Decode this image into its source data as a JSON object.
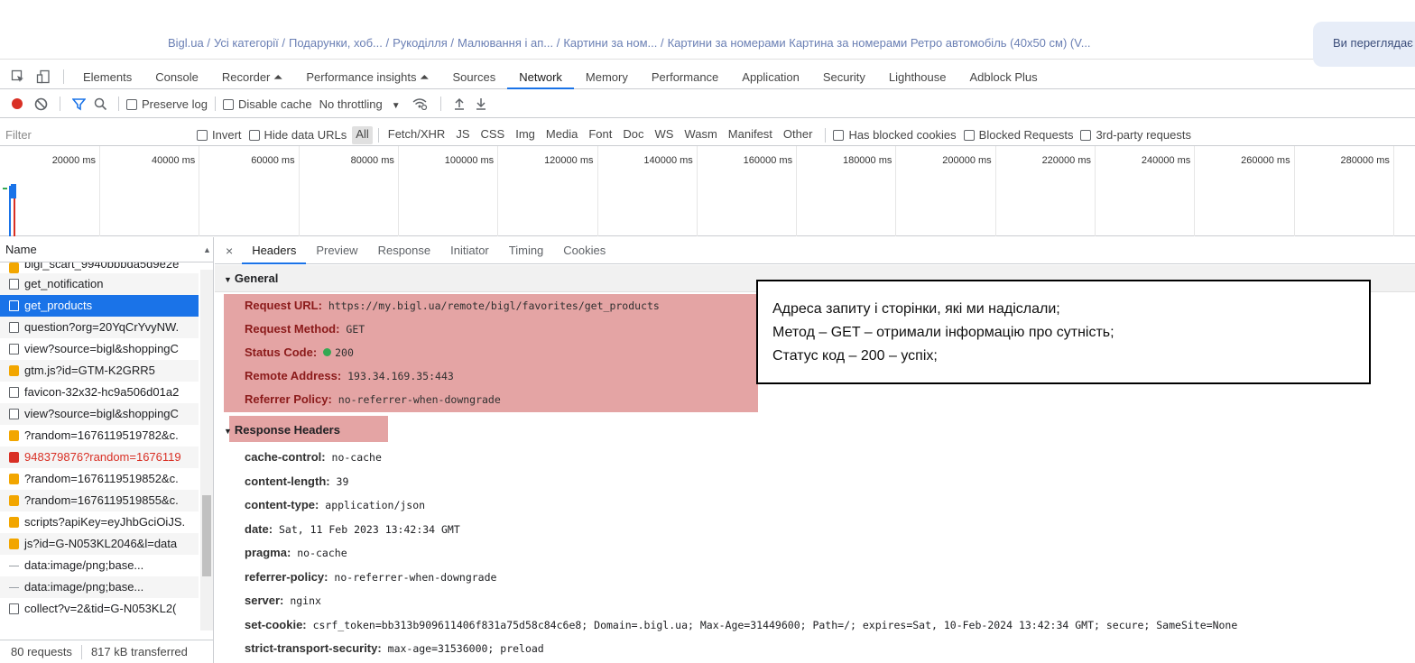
{
  "breadcrumb": [
    "Bigl.ua /",
    "Усі категорії /",
    "Подарунки, хоб... /",
    "Рукоділля /",
    "Малювання і ап... /",
    "Картини за ном... /",
    "Картини за номерами Картина за номерами Ретро автомобіль (40x50 см) (V..."
  ],
  "banner_text": "Ви переглядає",
  "devtools_tabs": [
    "Elements",
    "Console",
    "Recorder ⏶",
    "Performance insights ⏶",
    "Sources",
    "Network",
    "Memory",
    "Performance",
    "Application",
    "Security",
    "Lighthouse",
    "Adblock Plus"
  ],
  "active_tab": "Network",
  "toolbar": {
    "preserve_log": "Preserve log",
    "disable_cache": "Disable cache",
    "throttling": "No throttling"
  },
  "filter": {
    "placeholder": "Filter",
    "invert": "Invert",
    "hide_data_urls": "Hide data URLs",
    "types": [
      "All",
      "Fetch/XHR",
      "JS",
      "CSS",
      "Img",
      "Media",
      "Font",
      "Doc",
      "WS",
      "Wasm",
      "Manifest",
      "Other"
    ],
    "has_blocked_cookies": "Has blocked cookies",
    "blocked_requests": "Blocked Requests",
    "third_party": "3rd-party requests"
  },
  "timeline_ticks": [
    "20000 ms",
    "40000 ms",
    "60000 ms",
    "80000 ms",
    "100000 ms",
    "120000 ms",
    "140000 ms",
    "160000 ms",
    "180000 ms",
    "200000 ms",
    "220000 ms",
    "240000 ms",
    "260000 ms",
    "280000 ms"
  ],
  "name_panel": {
    "header": "Name",
    "rows": [
      {
        "name": "bigl_scart_9940bbbda5d9e2e",
        "icon": "js"
      },
      {
        "name": "get_notification",
        "icon": "doc"
      },
      {
        "name": "get_products",
        "icon": "doc",
        "selected": true
      },
      {
        "name": "question?org=20YqCrYvyNW.",
        "icon": "doc"
      },
      {
        "name": "view?source=bigl&shoppingC",
        "icon": "doc"
      },
      {
        "name": "gtm.js?id=GTM-K2GRR5",
        "icon": "js"
      },
      {
        "name": "favicon-32x32-hc9a506d01a2",
        "icon": "doc"
      },
      {
        "name": "view?source=bigl&shoppingC",
        "icon": "doc"
      },
      {
        "name": "?random=1676119519782&c.",
        "icon": "js"
      },
      {
        "name": "948379876?random=1676119",
        "icon": "err",
        "error": true
      },
      {
        "name": "?random=1676119519852&c.",
        "icon": "js"
      },
      {
        "name": "?random=1676119519855&c.",
        "icon": "js"
      },
      {
        "name": "scripts?apiKey=eyJhbGciOiJS.",
        "icon": "js"
      },
      {
        "name": "js?id=G-N053KL2046&l=data",
        "icon": "js"
      },
      {
        "name": "data:image/png;base...",
        "icon": "dash"
      },
      {
        "name": "data:image/png;base...",
        "icon": "dash"
      },
      {
        "name": "collect?v=2&tid=G-N053KL2(",
        "icon": "doc"
      }
    ],
    "footer_requests": "80 requests",
    "footer_transferred": "817 kB transferred"
  },
  "detail_tabs": [
    "Headers",
    "Preview",
    "Response",
    "Initiator",
    "Timing",
    "Cookies"
  ],
  "active_detail_tab": "Headers",
  "general": {
    "title": "General",
    "rows": [
      {
        "key": "Request URL:",
        "value": "https://my.bigl.ua/remote/bigl/favorites/get_products"
      },
      {
        "key": "Request Method:",
        "value": "GET"
      },
      {
        "key": "Status Code:",
        "value": "200"
      },
      {
        "key": "Remote Address:",
        "value": "193.34.169.35:443"
      },
      {
        "key": "Referrer Policy:",
        "value": "no-referrer-when-downgrade"
      }
    ]
  },
  "response_headers": {
    "title": "Response Headers",
    "rows": [
      {
        "key": "cache-control:",
        "value": "no-cache"
      },
      {
        "key": "content-length:",
        "value": "39"
      },
      {
        "key": "content-type:",
        "value": "application/json"
      },
      {
        "key": "date:",
        "value": "Sat, 11 Feb 2023 13:42:34 GMT"
      },
      {
        "key": "pragma:",
        "value": "no-cache"
      },
      {
        "key": "referrer-policy:",
        "value": "no-referrer-when-downgrade"
      },
      {
        "key": "server:",
        "value": "nginx"
      },
      {
        "key": "set-cookie:",
        "value": "csrf_token=bb313b909611406f831a75d58c84c6e8; Domain=.bigl.ua; Max-Age=31449600; Path=/; expires=Sat, 10-Feb-2024 13:42:34 GMT; secure; SameSite=None"
      },
      {
        "key": "strict-transport-security:",
        "value": "max-age=31536000; preload"
      }
    ]
  },
  "callout": [
    "Адреса запиту і сторінки, які ми надіслали;",
    "Метод – GET – отримали інформацію про сутність;",
    "Статус код – 200 – успіх;"
  ],
  "colors": {
    "accent": "#1a73e8",
    "record": "#d93025",
    "highlight": "#e4a4a4",
    "status_ok": "#34a853"
  }
}
